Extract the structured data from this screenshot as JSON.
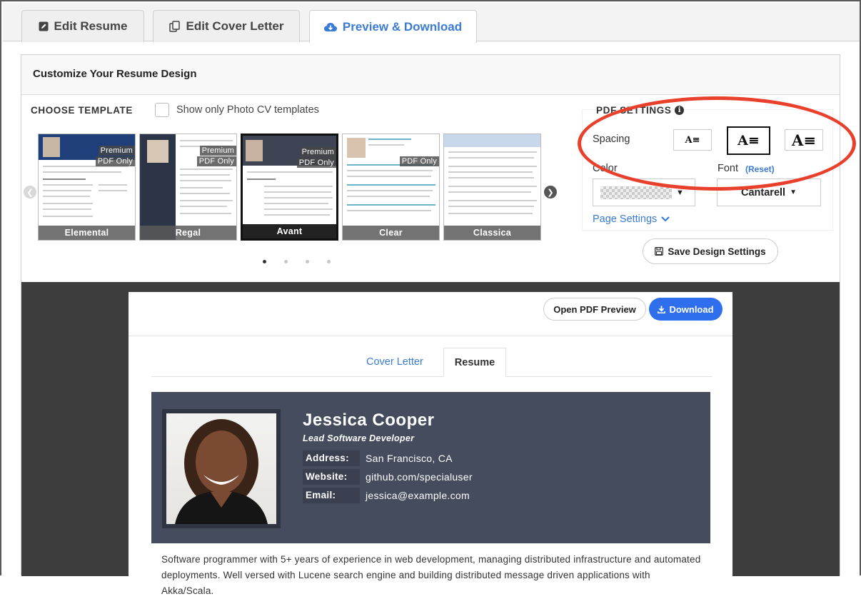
{
  "tabs": {
    "edit_resume": "Edit Resume",
    "edit_cover_letter": "Edit Cover Letter",
    "preview_download": "Preview & Download"
  },
  "panel": {
    "title": "Customize Your Resume Design"
  },
  "templates": {
    "label": "CHOOSE TEMPLATE",
    "photo_only_label": "Show only Photo CV templates",
    "items": [
      {
        "name": "Elemental",
        "badge1": "Premium",
        "badge2": "PDF Only"
      },
      {
        "name": "Regal",
        "badge1": "Premium",
        "badge2": "PDF Only"
      },
      {
        "name": "Avant",
        "badge1": "Premium",
        "badge2": "PDF Only"
      },
      {
        "name": "Clear",
        "badge1": "",
        "badge2": "PDF Only"
      },
      {
        "name": "Classica",
        "badge1": "",
        "badge2": ""
      }
    ],
    "selected_index": 2,
    "page_count": 4,
    "current_page": 1
  },
  "pdf_settings": {
    "title": "PDF SETTINGS",
    "spacing_label": "Spacing",
    "spacing_selected": "medium",
    "color_label": "Color",
    "font_label": "Font",
    "reset_label": "(Reset)",
    "font_value": "Cantarell",
    "page_settings_label": "Page Settings",
    "save_label": "Save Design Settings"
  },
  "preview": {
    "open_pdf_label": "Open PDF Preview",
    "download_label": "Download",
    "tab_cover": "Cover Letter",
    "tab_resume": "Resume"
  },
  "resume": {
    "name": "Jessica Cooper",
    "title": "Lead Software Developer",
    "address_key": "Address:",
    "address_val": "San Francisco, CA",
    "website_key": "Website:",
    "website_val": "github.com/specialuser",
    "email_key": "Email:",
    "email_val": "jessica@example.com",
    "summary": "Software programmer with 5+ years of experience in web development, managing distributed infrastructure and automated deployments. Well versed with Lucene search engine and building distributed message driven applications with Akka/Scala."
  },
  "colors": {
    "accent": "#3a7bd5",
    "download": "#2f6fee",
    "header_bg": "#454c5e",
    "highlight": "#e8402a"
  }
}
